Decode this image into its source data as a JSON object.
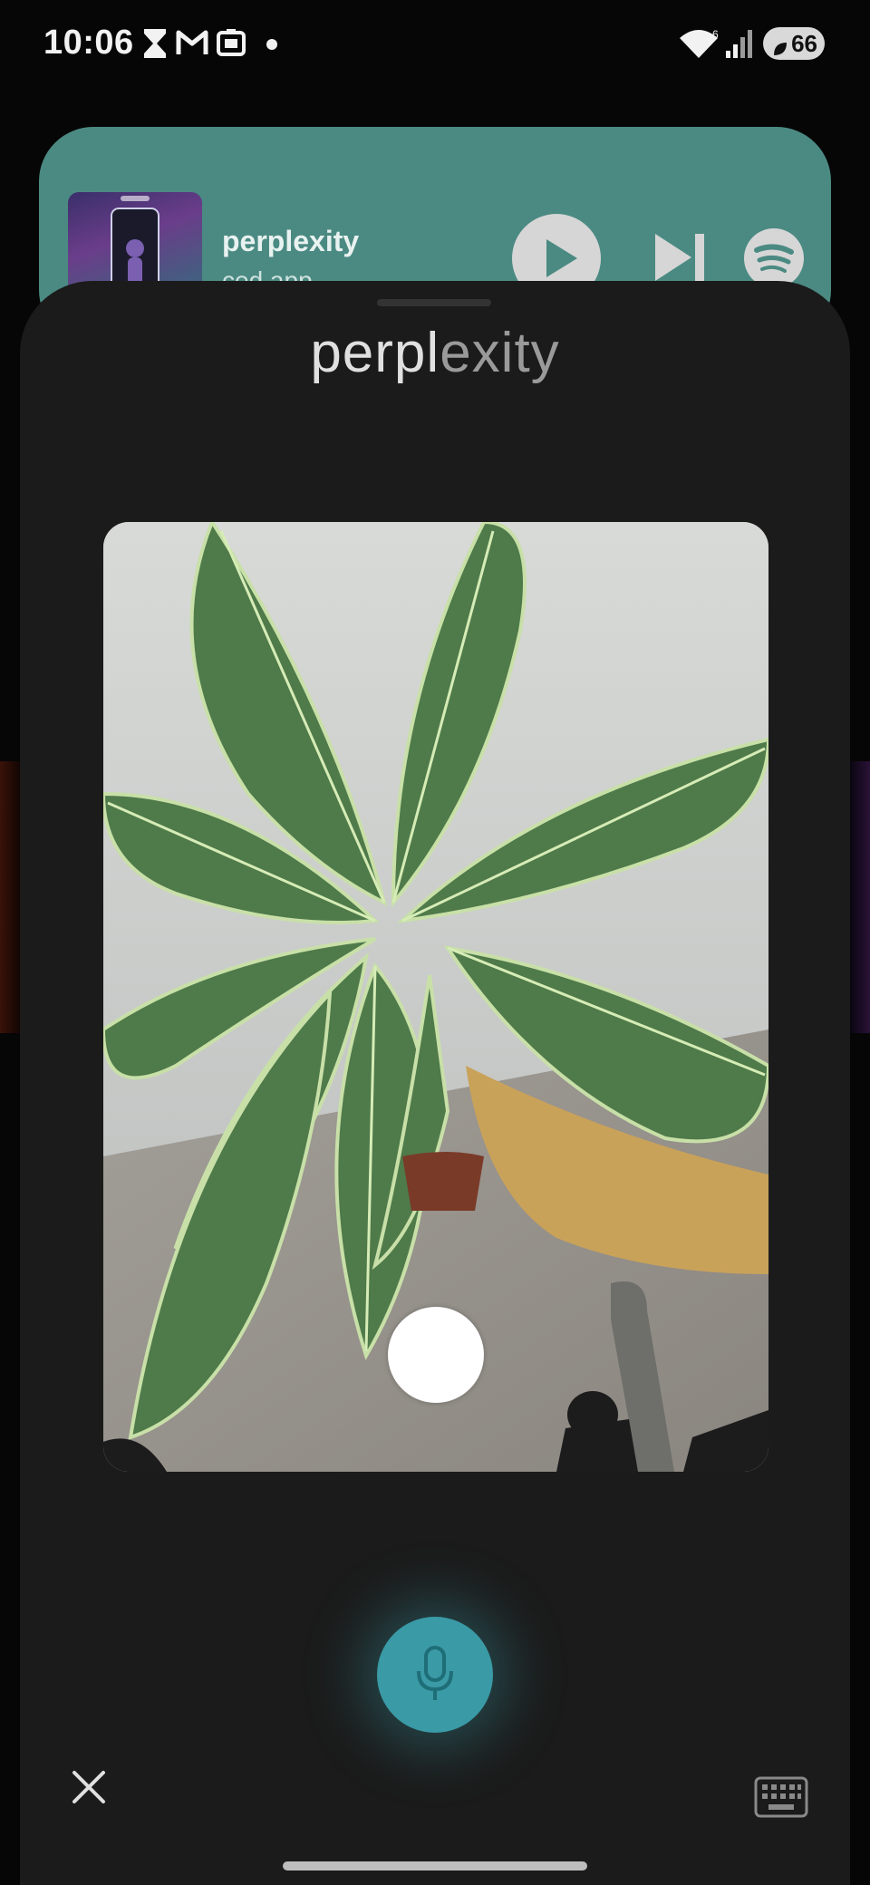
{
  "status_bar": {
    "time": "10:06",
    "battery_level": "66",
    "icons": [
      "hourglass-icon",
      "gmail-icon",
      "screenshot-icon",
      "dot-icon",
      "wifi-icon",
      "signal-icon",
      "battery-icon"
    ]
  },
  "media_notification": {
    "title": "perplexity",
    "subtitle": "ced app",
    "controls": [
      "play-icon",
      "skip-next-icon",
      "spotify-icon"
    ],
    "background_color": "#4b8a82"
  },
  "assistant_sheet": {
    "brand_primary": "perpl",
    "brand_secondary": "exity",
    "camera_view": "camera-preview",
    "shutter": "shutter-button",
    "mic": "microphone-icon",
    "close": "close-icon",
    "keyboard": "keyboard-icon",
    "accent_color": "#3a9aa6"
  }
}
